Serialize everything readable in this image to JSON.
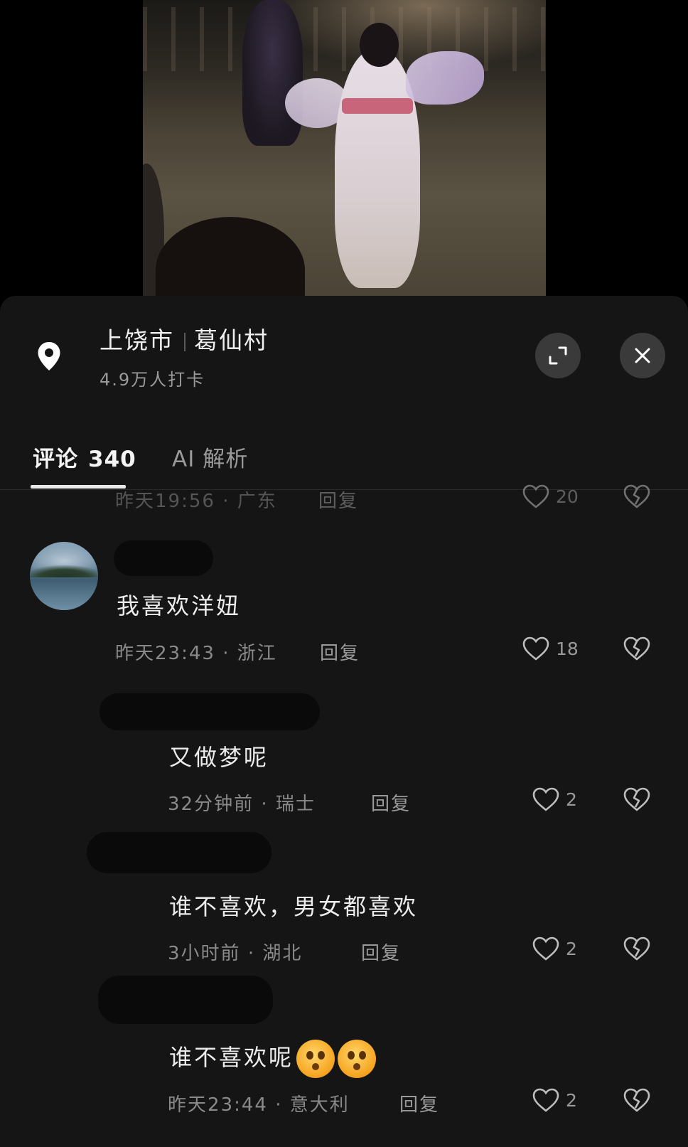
{
  "location": {
    "city": "上饶市",
    "place": "葛仙村",
    "checkins": "4.9万人打卡"
  },
  "tabs": {
    "comments_label": "评论",
    "comments_count": "340",
    "ai_label": "AI 解析"
  },
  "partial_comment": {
    "meta": "昨天19:56 · 广东",
    "reply": "回复",
    "likes": "20"
  },
  "comments": [
    {
      "text": "我喜欢洋妞",
      "time": "昨天23:43",
      "region": "浙江",
      "reply": "回复",
      "likes": "18"
    },
    {
      "text": "又做梦呢",
      "time": "32分钟前",
      "region": "瑞士",
      "reply": "回复",
      "likes": "2"
    },
    {
      "text": "谁不喜欢，男女都喜欢",
      "time": "3小时前",
      "region": "湖北",
      "reply": "回复",
      "likes": "2"
    },
    {
      "text": "谁不喜欢呢",
      "time": "昨天23:44",
      "region": "意大利",
      "reply": "回复",
      "likes": "2"
    }
  ],
  "separator": "·",
  "icons": {
    "location": "location-pin-icon",
    "expand": "expand-icon",
    "close": "close-icon",
    "like": "heart-outline-icon",
    "dislike": "broken-heart-icon",
    "emoji": "astonished-face-emoji"
  },
  "colors": {
    "sheet_background": "#151515",
    "text_primary": "#ececec",
    "text_secondary": "#8a8a8a",
    "button_background": "#3a3a3a"
  }
}
